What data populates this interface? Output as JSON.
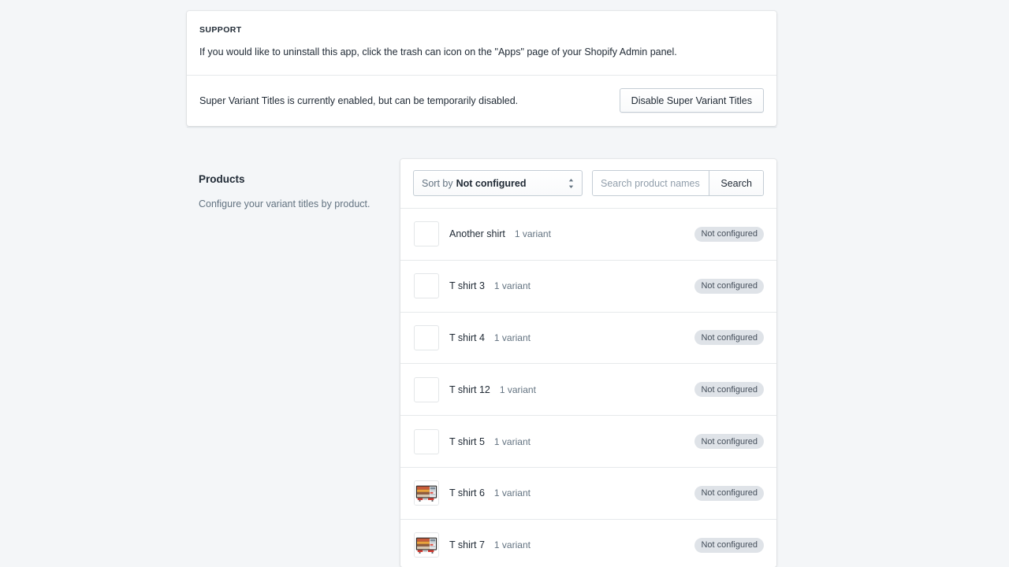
{
  "support": {
    "heading": "SUPPORT",
    "body": "If you would like to uninstall this app, click the trash can icon on the \"Apps\" page of your Shopify Admin panel.",
    "status_text": "Super Variant Titles is currently enabled, but can be temporarily disabled.",
    "disable_button": "Disable Super Variant Titles"
  },
  "products_section": {
    "title": "Products",
    "description": "Configure your variant titles by product."
  },
  "toolbar": {
    "sort_label": "Sort by",
    "sort_value": "Not configured",
    "sort_icon": "stepper-updown-icon",
    "search_placeholder": "Search product names",
    "search_value": "",
    "search_button": "Search"
  },
  "colors": {
    "page_background": "#f4f6f8",
    "card_background": "#ffffff",
    "text_primary": "#212b36",
    "text_subdued": "#637381",
    "border": "#c4cdd5",
    "divider": "#e6e9eb",
    "badge_background": "#dfe3e8",
    "badge_text": "#454f5b"
  },
  "products": [
    {
      "name": "Another shirt",
      "variants": "1 variant",
      "status": "Not configured",
      "thumbnail": "placeholder"
    },
    {
      "name": "T shirt 3",
      "variants": "1 variant",
      "status": "Not configured",
      "thumbnail": "placeholder"
    },
    {
      "name": "T shirt 4",
      "variants": "1 variant",
      "status": "Not configured",
      "thumbnail": "placeholder"
    },
    {
      "name": "T shirt 12",
      "variants": "1 variant",
      "status": "Not configured",
      "thumbnail": "placeholder"
    },
    {
      "name": "T shirt 5",
      "variants": "1 variant",
      "status": "Not configured",
      "thumbnail": "placeholder"
    },
    {
      "name": "T shirt 6",
      "variants": "1 variant",
      "status": "Not configured",
      "thumbnail": "television-image"
    },
    {
      "name": "T shirt 7",
      "variants": "1 variant",
      "status": "Not configured",
      "thumbnail": "television-image"
    }
  ]
}
